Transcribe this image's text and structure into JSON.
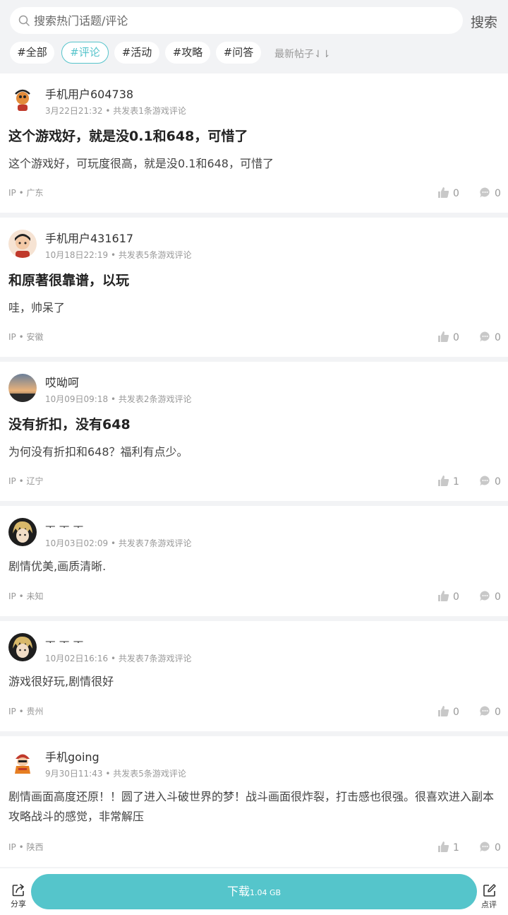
{
  "search": {
    "placeholder": "搜索热门话题/评论",
    "button": "搜索"
  },
  "tags": [
    "#全部",
    "#评论",
    "#活动",
    "#攻略",
    "#问答"
  ],
  "sort_label": "最新帖子⇃⇂",
  "accent_color": "#56c4cb",
  "posts": [
    {
      "username": "手机用户604738",
      "time": "3月22日21:32",
      "count": "共发表1条游戏评论",
      "title": "这个游戏好，就是没0.1和648，可惜了",
      "content": "这个游戏好，可玩度很高，就是没0.1和648，可惜了",
      "ip": "IP • 广东",
      "likes": "0",
      "comments": "0"
    },
    {
      "username": "手机用户431617",
      "time": "10月18日22:19",
      "count": "共发表5条游戏评论",
      "title": "和原著很靠谱，以玩",
      "content": "哇，帅呆了",
      "ip": "IP • 安徽",
      "likes": "0",
      "comments": "0"
    },
    {
      "username": "哎呦呵",
      "time": "10月09日09:18",
      "count": "共发表2条游戏评论",
      "title": "没有折扣，没有648",
      "content": "为何没有折扣和648？福利有点少。",
      "ip": "IP • 辽宁",
      "likes": "1",
      "comments": "0"
    },
    {
      "username": "ᅮ ᅮ ᅮ",
      "time": "10月03日02:09",
      "count": "共发表7条游戏评论",
      "content": "剧情优美,画质清晰.",
      "ip": "IP • 未知",
      "likes": "0",
      "comments": "0"
    },
    {
      "username": "ᅮ ᅮ ᅮ",
      "time": "10月02日16:16",
      "count": "共发表7条游戏评论",
      "content": "游戏很好玩,剧情很好",
      "ip": "IP • 贵州",
      "likes": "0",
      "comments": "0"
    },
    {
      "username": "手机going",
      "time": "9月30日11:43",
      "count": "共发表5条游戏评论",
      "content": "剧情画面高度还原！！圆了进入斗破世界的梦！战斗画面很炸裂，打击感也很强。很喜欢进入副本攻略战斗的感觉，非常解压",
      "ip": "IP • 陕西",
      "likes": "1",
      "comments": "0"
    }
  ],
  "bottom": {
    "share_label": "分享",
    "download_label": "下载",
    "download_size": "1.04 GB",
    "review_label": "点评"
  }
}
